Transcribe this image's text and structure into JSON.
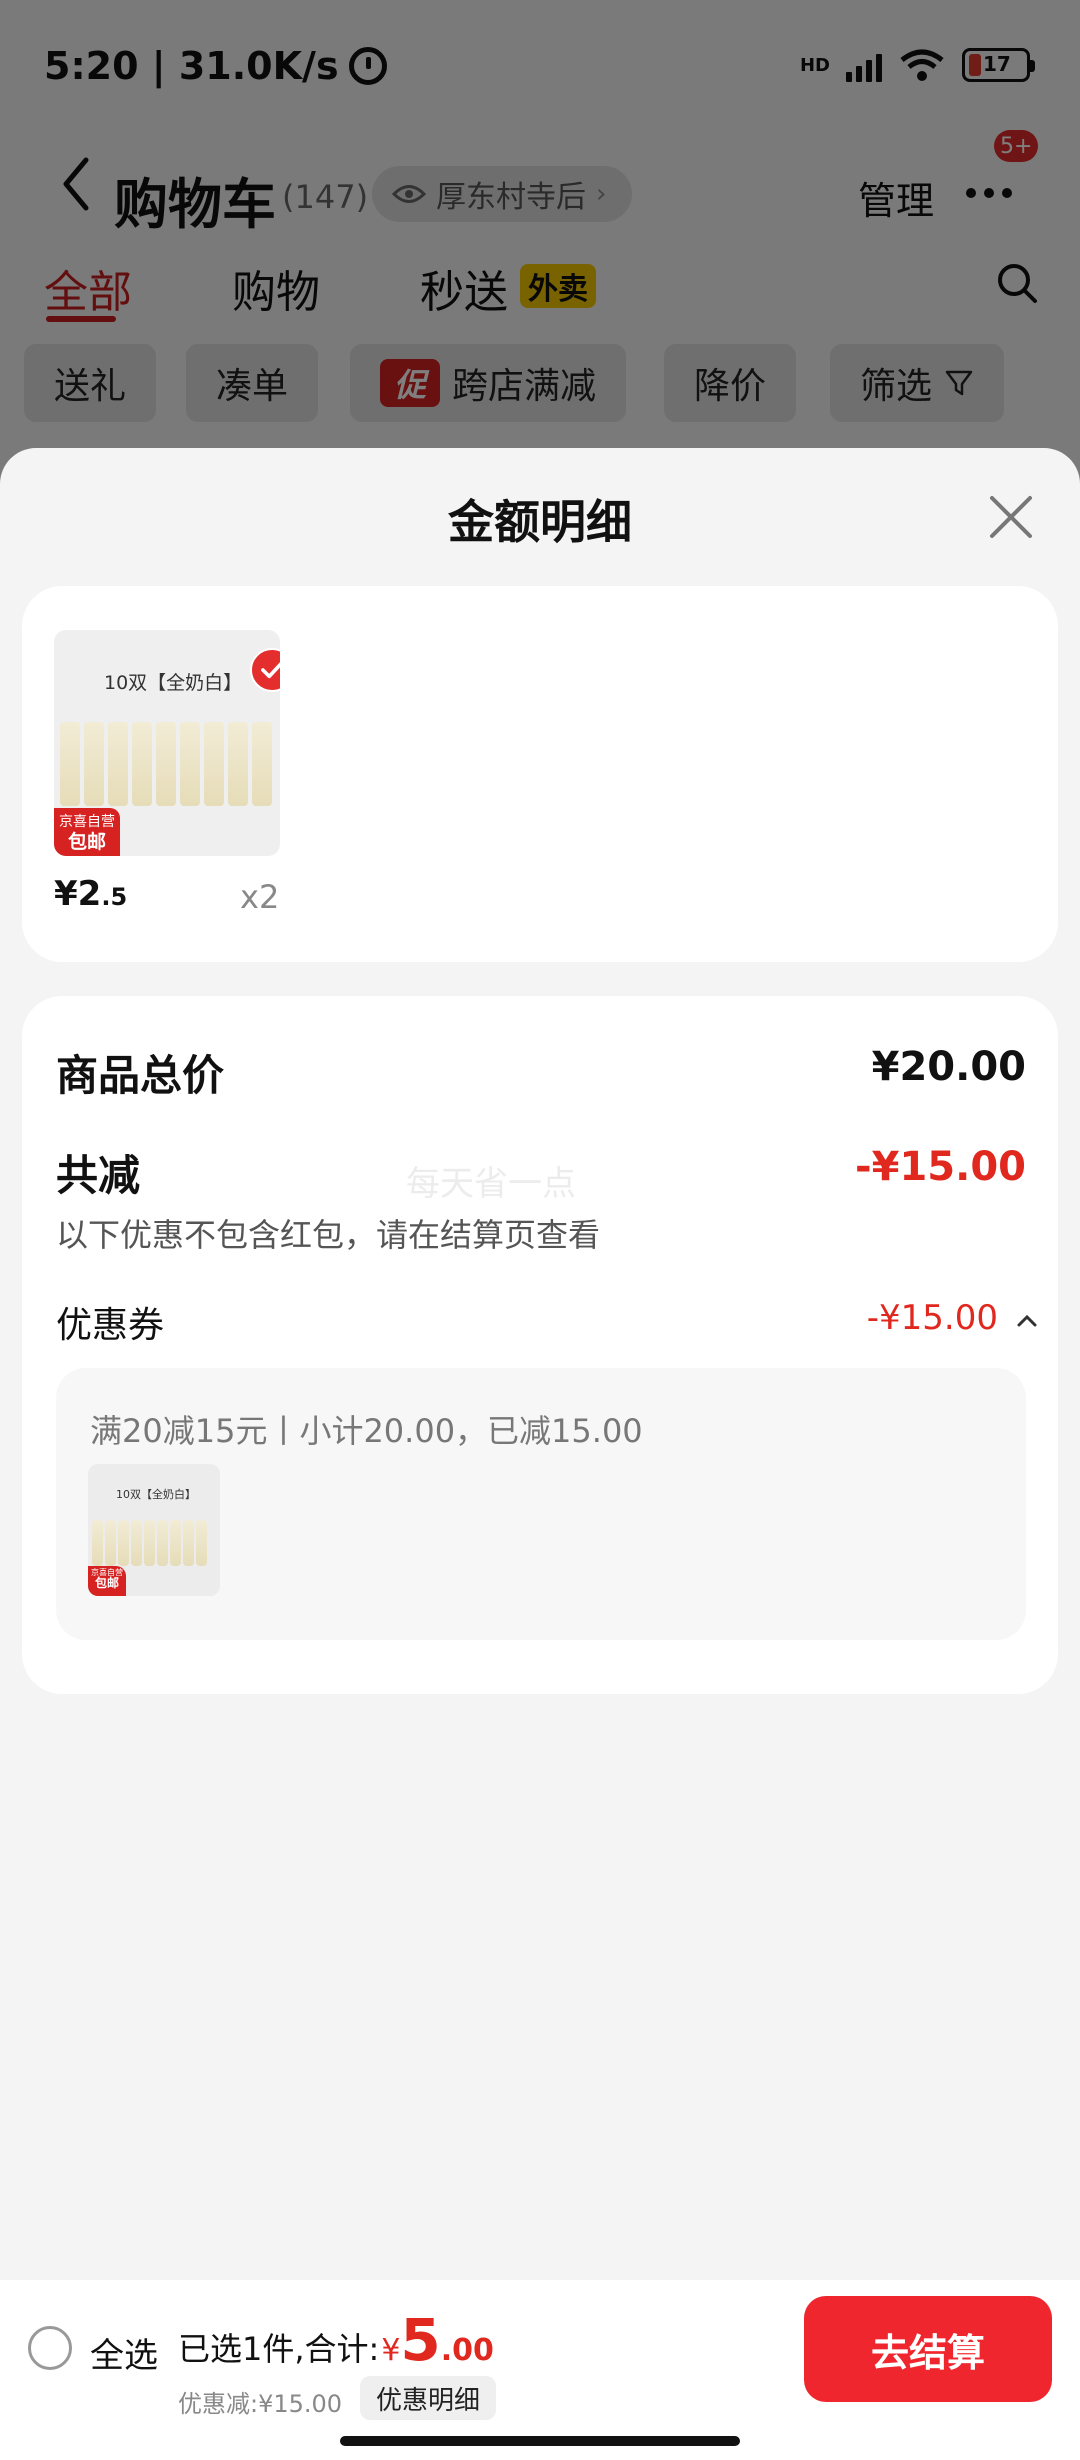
{
  "status_bar": {
    "time_speed": "5:20 | 31.0K/s",
    "network_label": "HD",
    "battery_level": "17"
  },
  "nav": {
    "title": "购物车",
    "count": "(147)",
    "location": "厚东村寺后",
    "manage_label": "管理",
    "notification_badge": "5+"
  },
  "tabs": [
    {
      "label": "全部"
    },
    {
      "label": "购物"
    },
    {
      "label": "秒送"
    }
  ],
  "waimai_badge": "外卖",
  "filter_chips": [
    {
      "label": "送礼"
    },
    {
      "label": "凑单"
    },
    {
      "label": "跨店满减"
    },
    {
      "label": "降价"
    },
    {
      "label": "筛选"
    }
  ],
  "promo_tag": "促",
  "sheet": {
    "title": "金额明细",
    "product": {
      "image_caption": "10双【全奶白】",
      "sock_text": "奶白",
      "badge_line1": "京喜自营",
      "badge_line2": "包邮",
      "price_symbol": "¥",
      "price_int": "2",
      "price_dec": ".5",
      "quantity": "x2"
    },
    "summary": {
      "total_label": "商品总价",
      "total_value": "¥20.00",
      "discount_label": "共减",
      "discount_value": "-¥15.00",
      "note": "以下优惠不包含红包，请在结算页查看",
      "watermark": "每天省一点",
      "coupon_label": "优惠券",
      "coupon_value": "-¥15.00",
      "coupon_desc": "满20减15元丨小计20.00，已减15.00",
      "mini_caption": "10双【全奶白】"
    }
  },
  "bottom_bar": {
    "select_all": "全选",
    "selected_prefix": "已选1件,合计:",
    "total_symbol": "¥",
    "total_int": "5",
    "total_dec": ".00",
    "discount_line": "优惠减:¥15.00",
    "detail_label": "优惠明细",
    "checkout_label": "去结算"
  },
  "colors": {
    "accent_red": "#e0281f",
    "checkout_red": "#f0262e",
    "waimai_yellow": "#f2c500"
  }
}
